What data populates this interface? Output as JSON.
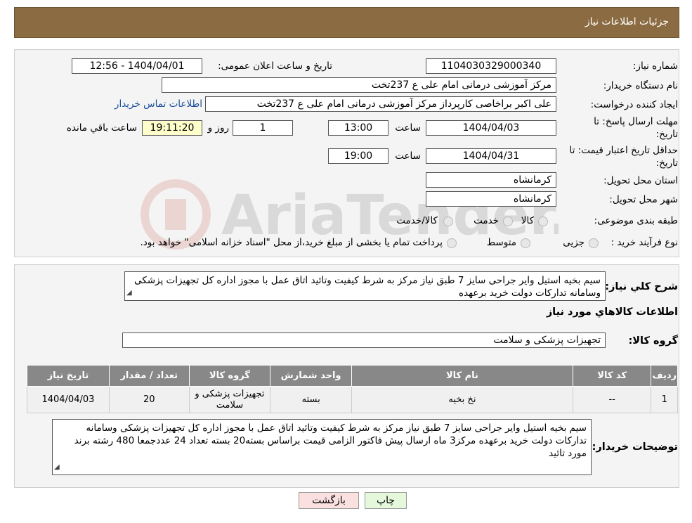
{
  "header": {
    "title": "جزئیات اطلاعات نیاز"
  },
  "watermark": {
    "text": "AriaTender.neT"
  },
  "fields": {
    "need_number_label": "شماره نیاز:",
    "need_number": "1104030329000340",
    "announce_label": "تاریخ و ساعت اعلان عمومی:",
    "announce_value": "1404/04/01 - 12:56",
    "buyer_org_label": "نام دستگاه خریدار:",
    "buyer_org": "مرکز آموزشی درمانی امام علی ع 237تخت",
    "requester_label": "ایجاد کننده درخواست:",
    "requester": "علی اکبر براخاصی کارپرداز  مرکز آموزشی درمانی امام علی ع 237تخت",
    "contact_link": "اطلاعات تماس خریدار",
    "deadline_label_1": "مهلت ارسال پاسخ: تا",
    "deadline_label_2": "تاریخ:",
    "deadline_date": "1404/04/03",
    "time_label": "ساعت",
    "deadline_time": "13:00",
    "days_value": "1",
    "days_label": "روز و",
    "remaining_time": "19:11:20",
    "remaining_label": "ساعت باقي مانده",
    "validity_label_1": "حداقل تاریخ اعتبار قیمت: تا",
    "validity_label_2": "تاریخ:",
    "validity_date": "1404/04/31",
    "validity_time": "19:00",
    "province_label": "استان محل تحویل:",
    "province": "کرمانشاه",
    "city_label": "شهر محل تحویل:",
    "city": "کرمانشاه",
    "category_label": "طبقه بندی موضوعی:",
    "category_options": [
      "کالا",
      "خدمت",
      "کالا/خدمت"
    ],
    "process_label": "نوع فرآیند خرید :",
    "process_options": [
      "جزیی",
      "متوسط"
    ],
    "process_note": "پرداخت تمام یا بخشی از مبلغ خرید،از محل \"اسناد خزانه اسلامی\" خواهد بود."
  },
  "summary": {
    "label": "شرح کلي نياز:",
    "text": "سیم بخیه استیل وایر جراحی سایز 7 طبق نیاز مرکز به شرط کیفیت وتائید اتاق عمل با مجوز اداره کل تجهیزات پزشکی وسامانه تدارکات دولت خرید برعهده"
  },
  "goods": {
    "section_title": "اطلاعات کالاهاي مورد نياز",
    "group_label": "گروه کالا:",
    "group_value": "تجهیزات پزشکی و سلامت",
    "table": {
      "headers": [
        "ردیف",
        "کد کالا",
        "نام کالا",
        "واحد شمارش",
        "گروه کالا",
        "تعداد / مقدار",
        "تاریخ نیاز"
      ],
      "rows": [
        [
          "1",
          "--",
          "نخ بخیه",
          "بسته",
          "تجهیزات پزشکی و سلامت",
          "20",
          "1404/04/03"
        ]
      ]
    }
  },
  "buyer_notes": {
    "label": "توضیحات خریدار:",
    "text": "سیم بخیه استیل وایر جراحی سایز 7 طبق نیاز مرکز به شرط کیفیت وتائید اتاق عمل با مجوز اداره کل تجهیزات پزشکی وسامانه تدارکات دولت خرید برعهده مرکز3 ماه ارسال پیش فاکتور الزامی قیمت براساس بسته20 بسته تعداد 24 عددجمعا 480 رشته برند مورد تائید"
  },
  "buttons": {
    "print": "چاپ",
    "back": "بازگشت"
  },
  "colors": {
    "header_bg": "#8b6b42",
    "table_header_bg": "#888888",
    "link": "#1a4f9c"
  }
}
